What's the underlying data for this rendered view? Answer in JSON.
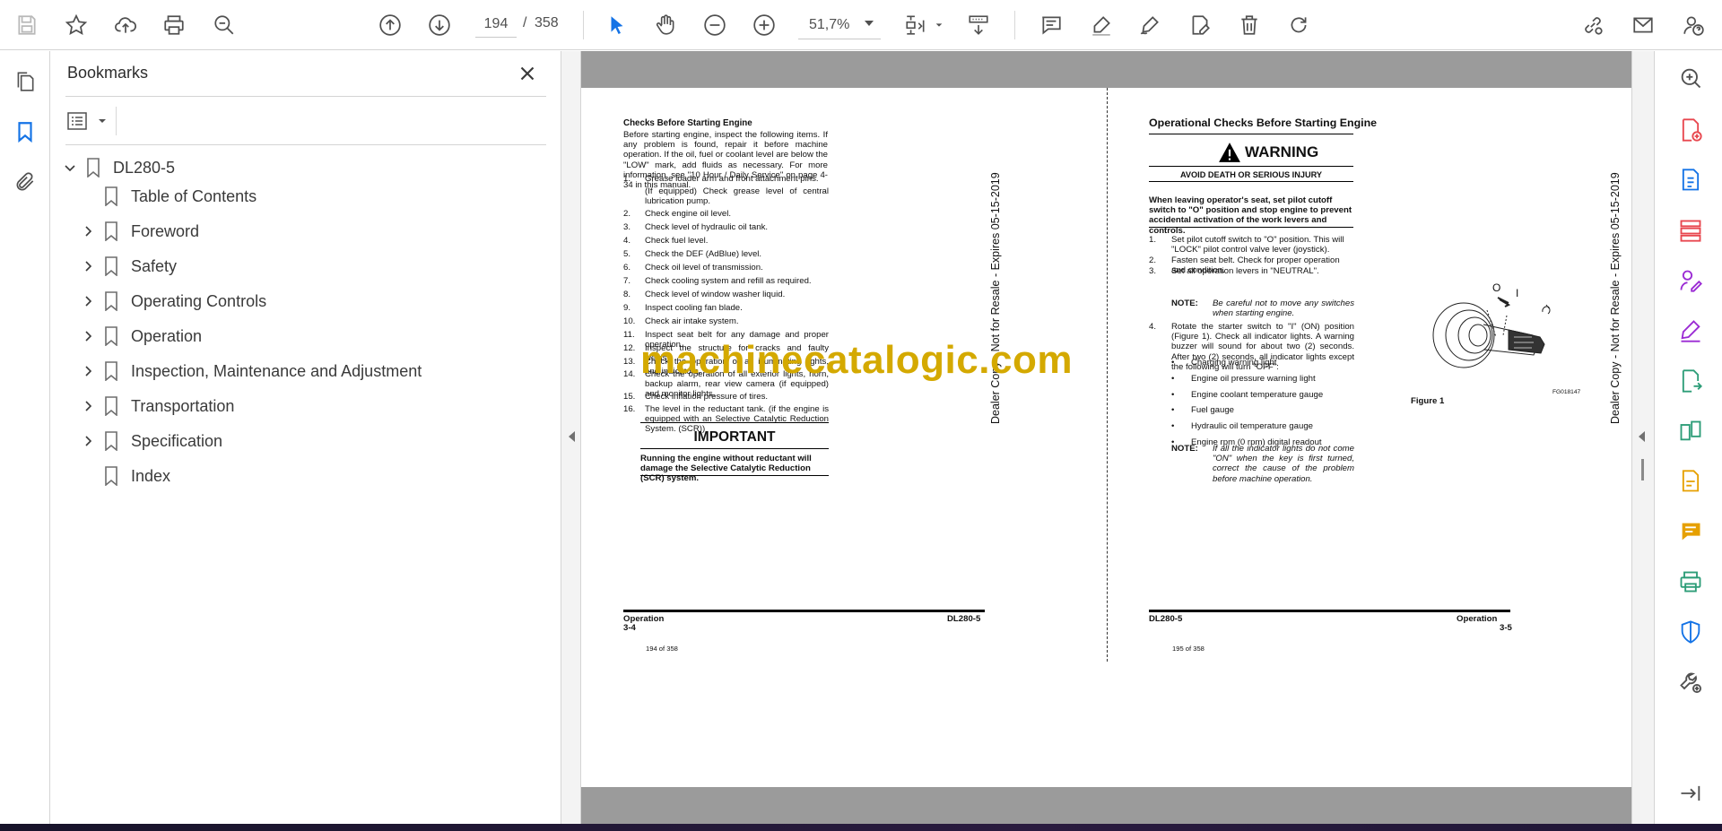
{
  "toolbar": {
    "page_current": "194",
    "page_separator": "/",
    "page_total": "358",
    "zoom": "51,7%"
  },
  "bookmarks": {
    "title": "Bookmarks",
    "root": "DL280-5",
    "items": [
      {
        "label": "Table of Contents",
        "expandable": false
      },
      {
        "label": "Foreword",
        "expandable": true
      },
      {
        "label": "Safety",
        "expandable": true
      },
      {
        "label": "Operating Controls",
        "expandable": true
      },
      {
        "label": "Operation",
        "expandable": true
      },
      {
        "label": "Inspection, Maintenance and Adjustment",
        "expandable": true
      },
      {
        "label": "Transportation",
        "expandable": true
      },
      {
        "label": "Specification",
        "expandable": true
      },
      {
        "label": "Index",
        "expandable": false
      }
    ]
  },
  "doc": {
    "left": {
      "heading": "Checks Before Starting Engine",
      "intro": "Before starting engine, inspect the following items. If any problem is found, repair it before machine operation. If the oil, fuel or coolant level are below the \"LOW\" mark, add fluids as necessary. For more information, see \"10 Hour / Daily Service\" on page 4-34 in this manual.",
      "items": [
        {
          "n": "1.",
          "t": "Grease loader arm and front attachment pins."
        },
        {
          "n": "",
          "t": "(If equipped) Check grease level of central lubrication pump."
        },
        {
          "n": "2.",
          "t": "Check engine oil level."
        },
        {
          "n": "3.",
          "t": "Check level of hydraulic oil tank."
        },
        {
          "n": "4.",
          "t": "Check fuel level."
        },
        {
          "n": "5.",
          "t": "Check the DEF (AdBlue) level."
        },
        {
          "n": "6.",
          "t": "Check oil level of transmission."
        },
        {
          "n": "7.",
          "t": "Check cooling system and refill as required."
        },
        {
          "n": "8.",
          "t": "Check level of window washer liquid."
        },
        {
          "n": "9.",
          "t": "Inspect cooling fan blade."
        },
        {
          "n": "10.",
          "t": "Check air intake system."
        },
        {
          "n": "11.",
          "t": "Inspect seat belt for any damage and proper operation."
        },
        {
          "n": "12.",
          "t": "Inspect the structure for cracks and faulty welds."
        },
        {
          "n": "13.",
          "t": "Check the operation of all illuminating lights, and indicators."
        },
        {
          "n": "14.",
          "t": "Check the operation of all exterior lights, horn, backup alarm, rear view camera (if equipped) and monitor lights."
        },
        {
          "n": "15.",
          "t": "Check inflation pressure of tires."
        },
        {
          "n": "16.",
          "t": "The level in the reductant tank. (if the engine is equipped with an Selective Catalytic Reduction System. (SCR))"
        }
      ],
      "important_title": "IMPORTANT",
      "important_text": "Running the engine without reductant will damage the Selective Catalytic Reduction (SCR) system.",
      "footer_left": "Operation",
      "footer_left2": "3-4",
      "footer_right": "DL280-5",
      "page_label": "194 of 358",
      "side_text": "Dealer Copy - Not for Resale - Expires 05-15-2019"
    },
    "right": {
      "heading": "Operational Checks Before Starting Engine",
      "warning_title": "WARNING",
      "warning_sub": "AVOID DEATH OR SERIOUS INJURY",
      "warning_text": "When leaving operator's seat, set pilot cutoff switch to \"O\" position and stop engine to prevent accidental activation of the work levers and controls.",
      "steps": [
        {
          "n": "1.",
          "t": "Set pilot cutoff switch to \"O\" position. This will \"LOCK\" pilot control valve lever (joystick)."
        },
        {
          "n": "2.",
          "t": "Fasten seat belt. Check for proper operation and condition."
        },
        {
          "n": "3.",
          "t": "Set all operation levers in \"NEUTRAL\"."
        }
      ],
      "note1_label": "NOTE:",
      "note1_text": "Be careful not to move any switches when starting engine.",
      "step4_n": "4.",
      "step4_text": "Rotate the starter switch to \"I\" (ON) position (Figure 1). Check all indicator lights. A warning buzzer will sound for about two (2) seconds. After two (2) seconds, all indicator lights except the following will turn \"OFF\":",
      "bullets": [
        "Charging warning light",
        "Engine oil pressure warning light",
        "Engine coolant temperature gauge",
        "Fuel gauge",
        "Hydraulic oil temperature gauge",
        "Engine rpm (0 rpm) digital readout"
      ],
      "note2_label": "NOTE:",
      "note2_text": "If all the indicator lights do not come \"ON\" when the key is first turned, correct the cause of the problem before machine operation.",
      "figure_caption": "Figure 1",
      "figure_code": "FG018147",
      "figure_label_o": "O",
      "figure_label_i": "I",
      "footer_left": "DL280-5",
      "footer_right": "Operation",
      "footer_right2": "3-5",
      "page_label": "195 of 358",
      "side_text": "Dealer Copy - Not for Resale - Expires 05-15-2019"
    },
    "watermark": "machinecatalogic.com"
  }
}
